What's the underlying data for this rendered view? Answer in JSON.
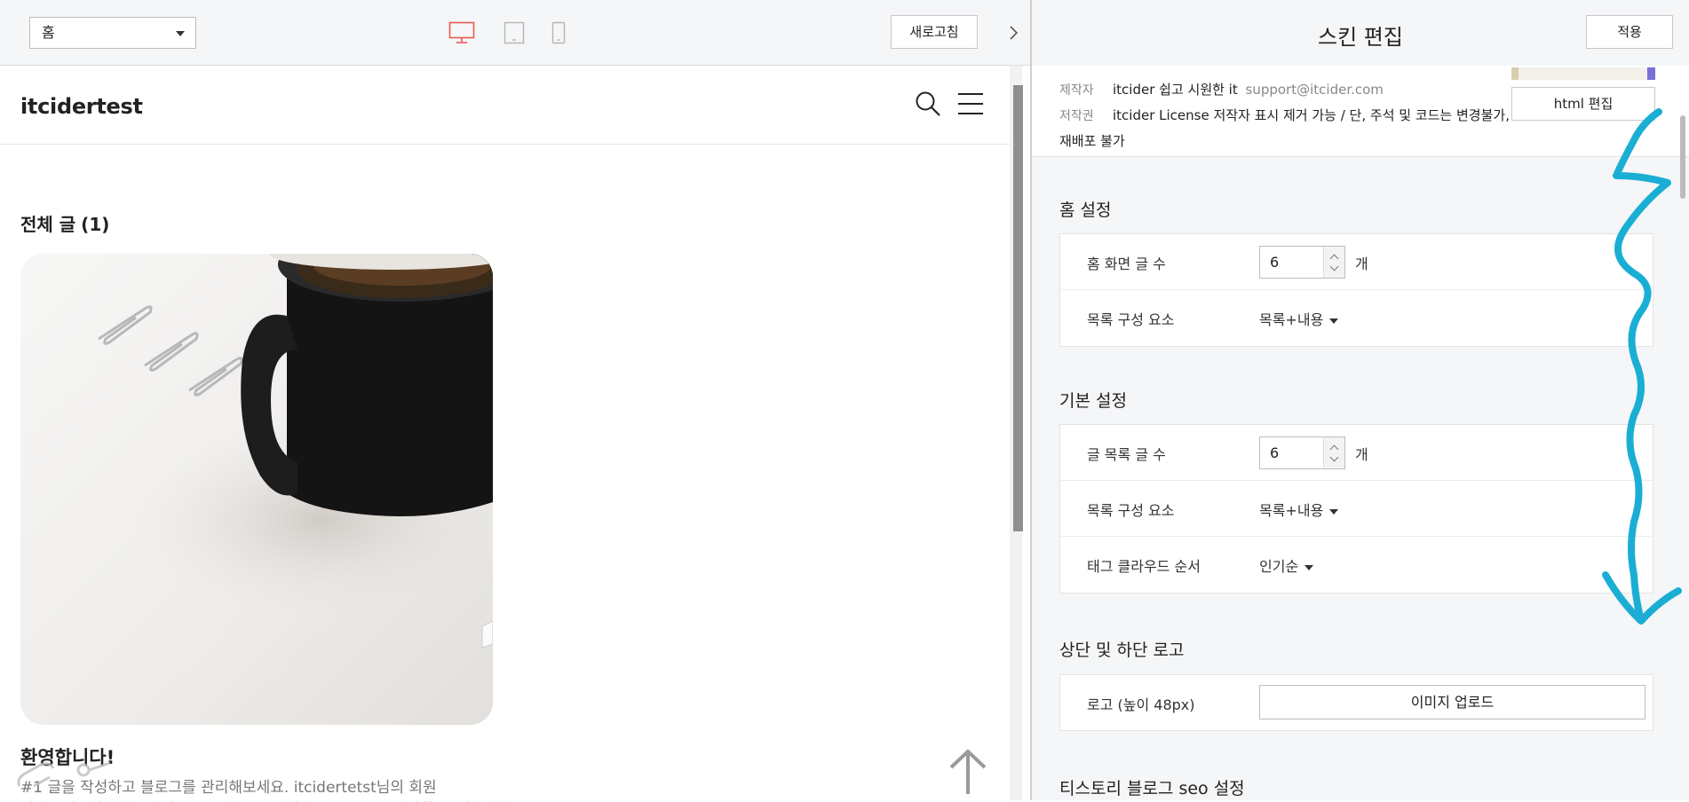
{
  "toolbar": {
    "page_select_value": "홈",
    "refresh_label": "새로고침",
    "device_active_color": "#e85a4f"
  },
  "blog": {
    "title": "itcidertest",
    "list_heading": "전체 글",
    "list_count": "(1)",
    "post_title": "환영합니다!",
    "post_excerpt": "#1 글을 작성하고 블로그를 관리해보세요. itcidertetst님의 회원",
    "post_excerpt2": "가입을 축하합니다. 이제 블로그에 글을 작성하고 블로그를 관리할 수 있습니다."
  },
  "editor": {
    "title": "스킨 편집",
    "apply_label": "적용",
    "html_edit_label": "html 편집",
    "info": {
      "author_label": "제작자",
      "author_value": "itcider 쉽고 시원한 it",
      "author_email": "support@itcider.com",
      "license_label": "저작권",
      "license_value": "itcider License 저작자 표시 제거 가능 / 단, 주석 및 코드는 변경불가,",
      "license_value2": "재배포 불가"
    },
    "home_settings": {
      "title": "홈 설정",
      "post_count_label": "홈 화면 글 수",
      "post_count_value": "6",
      "unit": "개",
      "components_label": "목록 구성 요소",
      "components_value": "목록+내용"
    },
    "basic_settings": {
      "title": "기본 설정",
      "post_count_label": "글 목록 글 수",
      "post_count_value": "6",
      "unit": "개",
      "components_label": "목록 구성 요소",
      "components_value": "목록+내용",
      "tag_order_label": "태그 클라우드 순서",
      "tag_order_value": "인기순"
    },
    "logo_settings": {
      "title": "상단 및 하단 로고",
      "logo_label": "로고 (높이 48px)",
      "upload_label": "이미지 업로드"
    },
    "seo_settings": {
      "title": "티스토리 블로그 seo 설정"
    }
  },
  "annotation_color": "#1aaed4"
}
